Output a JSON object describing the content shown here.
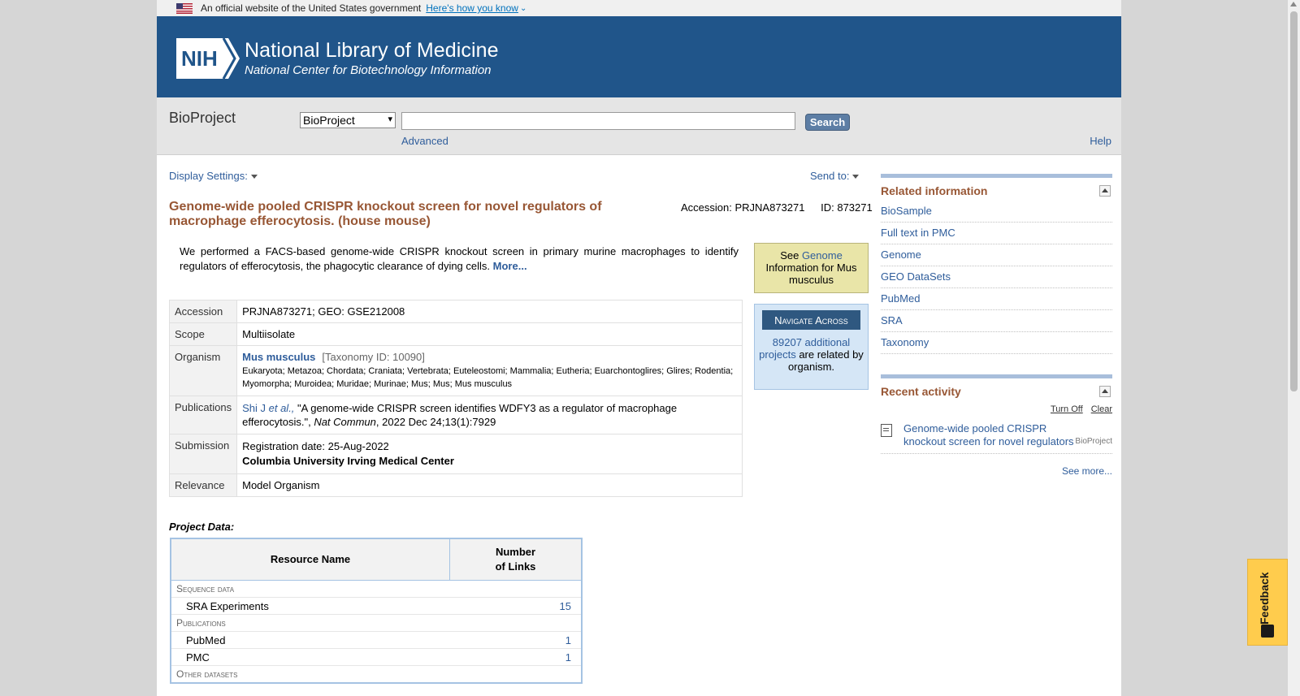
{
  "gov_banner": {
    "text": "An official website of the United States government",
    "link": "Here's how you know"
  },
  "header": {
    "logo_text": "NIH",
    "title": "National Library of Medicine",
    "subtitle": "National Center for Biotechnology Information"
  },
  "search": {
    "db_title": "BioProject",
    "db_select_value": "BioProject",
    "input_value": "",
    "button_label": "Search",
    "advanced_label": "Advanced",
    "help_label": "Help"
  },
  "toolbar": {
    "display_settings": "Display Settings:",
    "send_to": "Send to:"
  },
  "record": {
    "title": "Genome-wide pooled CRISPR knockout screen for novel regulators of macrophage efferocytosis. (house mouse)",
    "accession_label": "Accession: PRJNA873271",
    "id_label": "ID: 873271",
    "description": "We performed a FACS-based genome-wide CRISPR knockout screen in primary murine macrophages to identify regulators of efferocytosis, the phagocytic clearance of dying cells.",
    "more_label": "More..."
  },
  "details": {
    "accession": {
      "label": "Accession",
      "value": "PRJNA873271; GEO: GSE212008"
    },
    "scope": {
      "label": "Scope",
      "value": "Multiisolate"
    },
    "organism": {
      "label": "Organism",
      "name": "Mus musculus",
      "taxid": "[Taxonomy ID: 10090]",
      "lineage": "Eukaryota; Metazoa; Chordata; Craniata; Vertebrata; Euteleostomi; Mammalia; Eutheria; Euarchontoglires; Glires; Rodentia; Myomorpha; Muroidea; Muridae; Murinae; Mus; Mus; Mus musculus"
    },
    "publications": {
      "label": "Publications",
      "authors": "Shi J ",
      "etal": "et al.,",
      "article_title": " \"A genome-wide CRISPR screen identifies WDFY3 as a regulator of macrophage efferocytosis.\", ",
      "journal": "Nat Commun",
      "citation": ", 2022 Dec 24;13(1):7929"
    },
    "submission": {
      "label": "Submission",
      "date": "Registration date: 25-Aug-2022",
      "institution": "Columbia University Irving Medical Center"
    },
    "relevance": {
      "label": "Relevance",
      "value": "Model Organism"
    }
  },
  "genome_box": {
    "see": "See ",
    "link": "Genome",
    "rest": " Information for Mus musculus"
  },
  "nav_box": {
    "heading": "Navigate Across",
    "link": "89207 additional projects",
    "rest": " are related by organism."
  },
  "related": {
    "heading": "Related information",
    "items": [
      "BioSample",
      "Full text in PMC",
      "Genome",
      "GEO DataSets",
      "PubMed",
      "SRA",
      "Taxonomy"
    ]
  },
  "recent": {
    "heading": "Recent activity",
    "turn_off": "Turn Off",
    "clear": "Clear",
    "item_text": "Genome-wide pooled CRISPR knockout screen for novel regulators of macrophage efferocytosis. (house mouse)",
    "item_db": "BioProject",
    "see_more": "See more..."
  },
  "project_data": {
    "label": "Project Data:",
    "col_resource": "Resource Name",
    "col_links_1": "Number",
    "col_links_2": "of Links",
    "rows": [
      {
        "type": "cat",
        "name": "Sequence data"
      },
      {
        "type": "res",
        "name": "SRA Experiments",
        "count": "15"
      },
      {
        "type": "cat",
        "name": "Publications"
      },
      {
        "type": "res",
        "name": "PubMed",
        "count": "1"
      },
      {
        "type": "res",
        "name": "PMC",
        "count": "1"
      },
      {
        "type": "cat",
        "name": "Other datasets"
      }
    ]
  },
  "feedback": {
    "label": "Feedback"
  },
  "colors": {
    "header_blue": "#20558a",
    "title_brown": "#985735",
    "link_blue": "#2f5d9b",
    "genome_box": "#e9e5a8",
    "nav_box": "#d5e6f6",
    "feedback": "#ffcc4d"
  }
}
